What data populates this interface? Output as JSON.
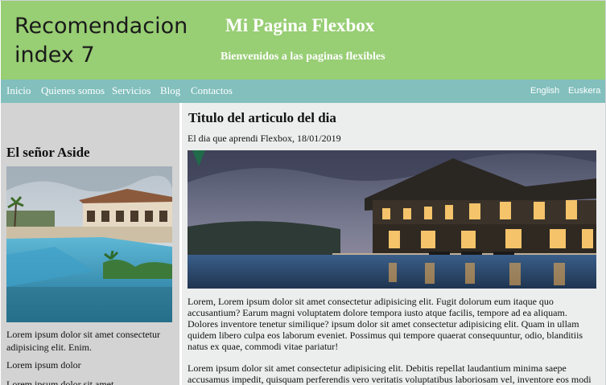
{
  "header": {
    "brand": "Recomendacion index 7",
    "title": "Mi Pagina Flexbox",
    "subtitle": "Bienvenidos a las paginas flexibles",
    "bg_color": "#98ce74"
  },
  "nav": {
    "bg_color": "#82bfbd",
    "links": [
      "Inicio",
      "Quienes somos",
      "Servicios",
      "Blog",
      "Contactos"
    ],
    "languages": [
      "English",
      "Euskera"
    ]
  },
  "aside": {
    "bg_color": "#d3d3d3",
    "title": "El señor Aside",
    "image": "pool-villa-image",
    "texts": [
      "Lorem ipsum dolor sit amet consectetur adipisicing elit. Enim.",
      "Lorem ipsum dolor",
      "Lorem ipsum dolor sit amet"
    ]
  },
  "article": {
    "title": "Titulo del articulo del dia",
    "meta": "El dia que aprendi Flexbox, 18/01/2019",
    "image": "luxury-house-night-image",
    "paragraphs": [
      "Lorem, Lorem ipsum dolor sit amet consectetur adipisicing elit. Fugit dolorum eum itaque quo accusantium? Earum magni voluptatem dolore tempora iusto atque facilis, tempore ad ea aliquam. Dolores inventore tenetur similique? ipsum dolor sit amet consectetur adipisicing elit. Quam in ullam quidem libero culpa eos laborum eveniet. Possimus qui tempore quaerat consequuntur, odio, blanditiis natus ex quae, commodi vitae pariatur!",
      "Lorem ipsum dolor sit amet consectetur adipisicing elit. Debitis repellat laudantium minima saepe accusamus impedit, quisquam perferendis vero veritatis voluptatibus laboriosam vel, inventore eos modi"
    ]
  }
}
